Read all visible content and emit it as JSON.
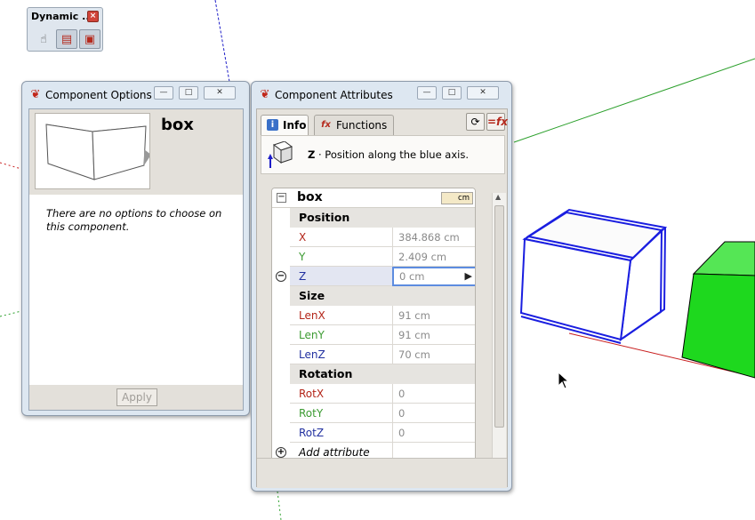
{
  "toolbar": {
    "title": "Dynamic ...",
    "close_glyph": "×",
    "buttons": [
      {
        "icon": "interact-hand-icon",
        "glyph": "☝"
      },
      {
        "icon": "component-options-icon",
        "glyph": "▤"
      },
      {
        "icon": "component-attributes-icon",
        "glyph": "▣"
      }
    ]
  },
  "options_window": {
    "title": "Component Options",
    "component_name": "box",
    "message": "There are no options to choose on this component.",
    "apply_label": "Apply",
    "minimize_glyph": "—",
    "maximize_glyph": "□",
    "close_glyph": "✕"
  },
  "attributes_window": {
    "title": "Component Attributes",
    "tabs": [
      {
        "label": "Info",
        "icon": "info-icon",
        "glyph": "i"
      },
      {
        "label": "Functions",
        "icon": "function-icon",
        "glyph": "fx"
      }
    ],
    "refresh_glyph": "⟳",
    "formula_glyph": "=fx",
    "info_key": "Z",
    "info_text": " · Position along the blue axis.",
    "root_name": "box",
    "units": "cm",
    "sections": [
      {
        "label": "Position",
        "rows": [
          {
            "name": "X",
            "value": "384.868 cm",
            "color": "#b32418"
          },
          {
            "name": "Y",
            "value": "2.409 cm",
            "color": "#3c9b32"
          },
          {
            "name": "Z",
            "value": "0 cm",
            "color": "#2231a0",
            "selected": true
          }
        ]
      },
      {
        "label": "Size",
        "rows": [
          {
            "name": "LenX",
            "value": "91 cm",
            "color": "#b32418"
          },
          {
            "name": "LenY",
            "value": "91 cm",
            "color": "#3c9b32"
          },
          {
            "name": "LenZ",
            "value": "70 cm",
            "color": "#2231a0"
          }
        ]
      },
      {
        "label": "Rotation",
        "rows": [
          {
            "name": "RotX",
            "value": "0",
            "color": "#b32418"
          },
          {
            "name": "RotY",
            "value": "0",
            "color": "#3c9b32"
          },
          {
            "name": "RotZ",
            "value": "0",
            "color": "#2231a0"
          }
        ]
      }
    ],
    "add_attribute_label": "Add attribute",
    "minimize_glyph": "—",
    "maximize_glyph": "□",
    "close_glyph": "✕"
  },
  "colors": {
    "selected_box": "#1a1ee0",
    "green_box": "#1ed81e",
    "red_axis": "#c81e1e",
    "green_axis": "#2ca02c",
    "blue_axis": "#1e1ec8"
  }
}
